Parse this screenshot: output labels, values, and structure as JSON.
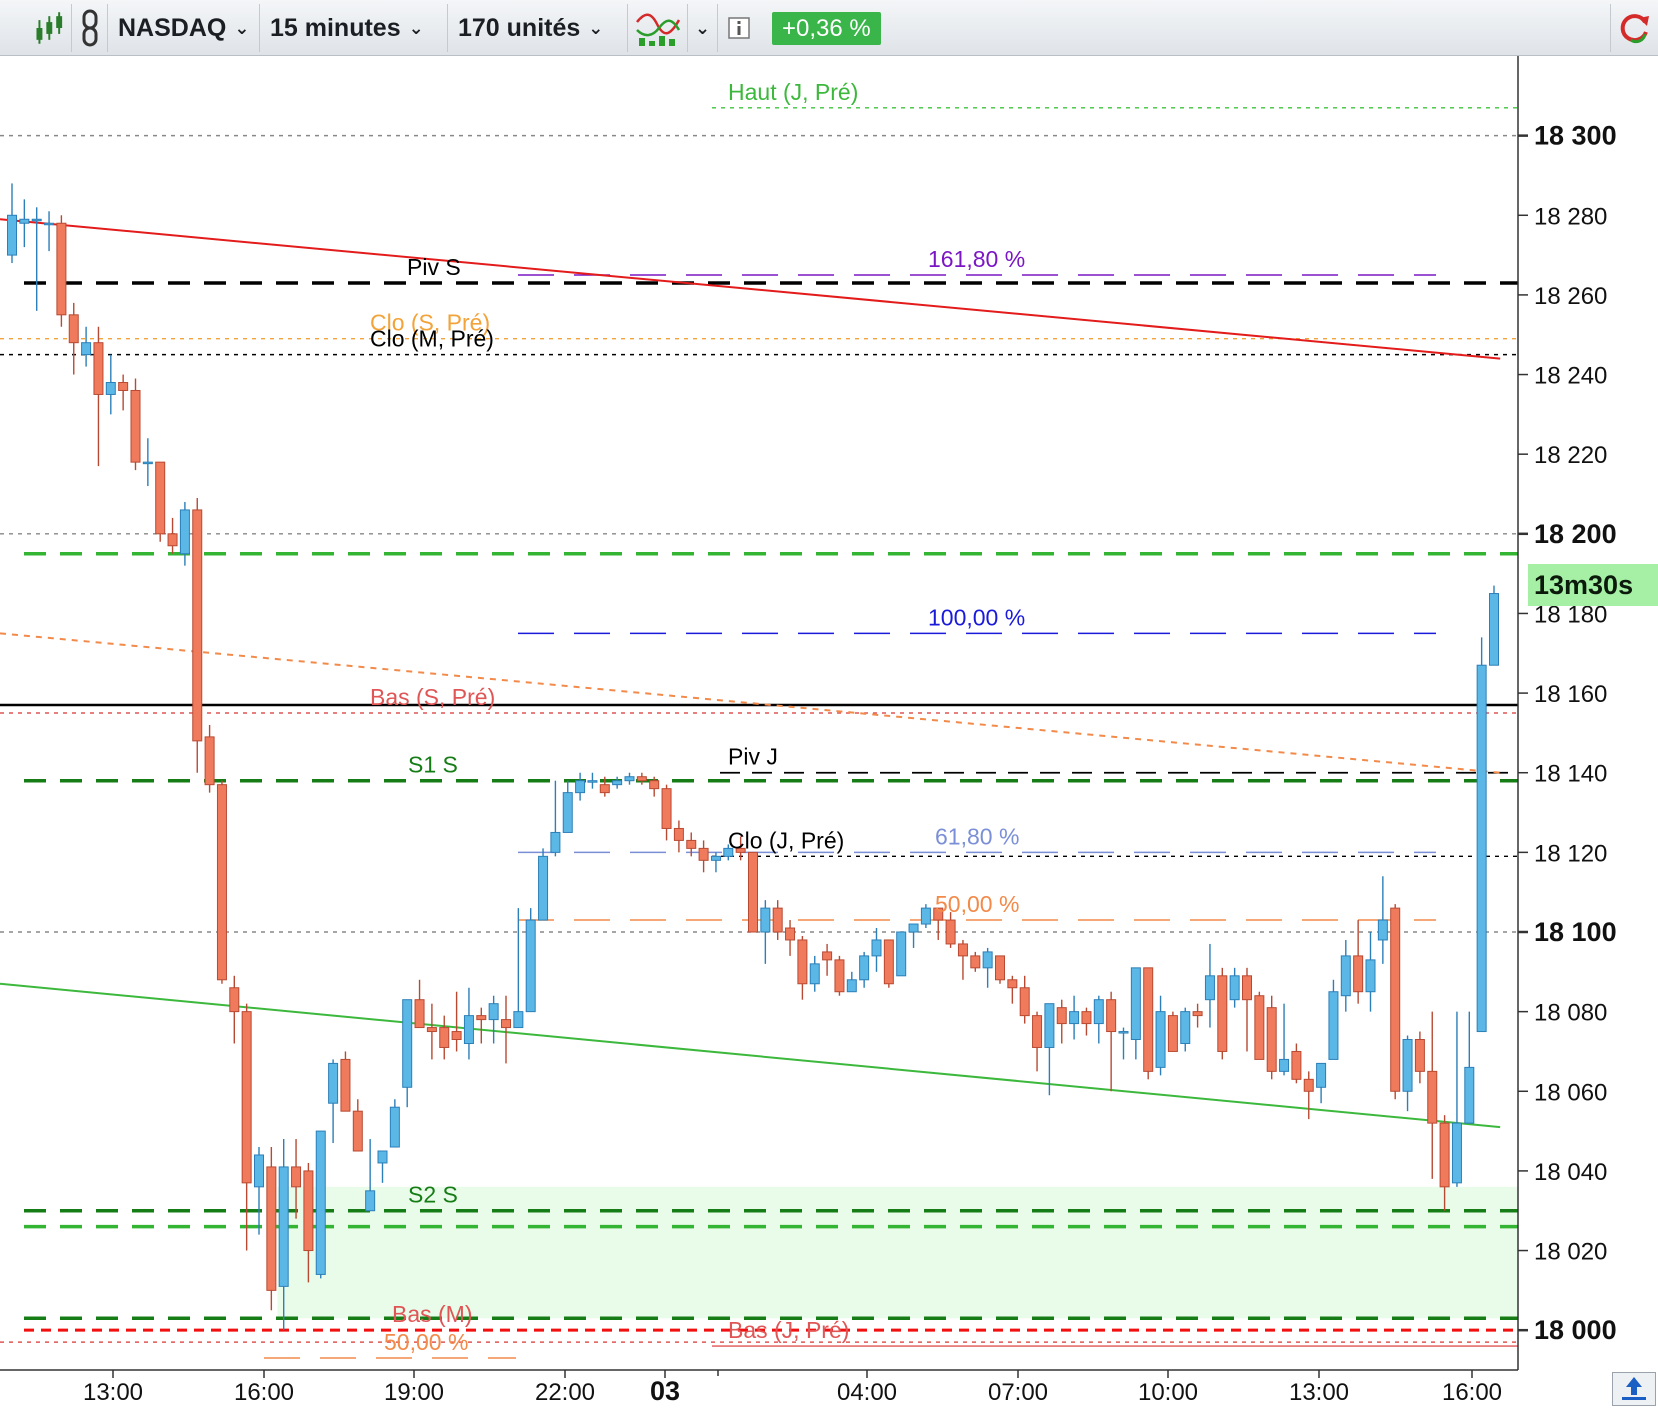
{
  "toolbar": {
    "symbol": "NASDAQ",
    "timeframe": "15 minutes",
    "units": "170 unités",
    "change": "+0,36 %",
    "icons": [
      "candlestick-icon",
      "link-icon",
      "indicator-icon",
      "info-icon",
      "refresh-icon"
    ]
  },
  "timer": "13m30s",
  "colors": {
    "up": "#5bb8e6",
    "down": "#f07a5c",
    "pivot_dark_green": "#167d16",
    "pivot_light_green": "#33b533",
    "fib_blue": "#1a1adb",
    "fib_purple": "#7b16c4",
    "fib_orange": "#f28a4a",
    "trend_red": "#e31b1b",
    "trend_green": "#3cb83c"
  },
  "chart_data": {
    "type": "candlestick",
    "ylim": [
      17990,
      18320
    ],
    "yticks": [
      {
        "value": 18300,
        "label": "18 300",
        "bold": true
      },
      {
        "value": 18280,
        "label": "18 280",
        "bold": false
      },
      {
        "value": 18260,
        "label": "18 260",
        "bold": false
      },
      {
        "value": 18240,
        "label": "18 240",
        "bold": false
      },
      {
        "value": 18220,
        "label": "18 220",
        "bold": false
      },
      {
        "value": 18200,
        "label": "18 200",
        "bold": true
      },
      {
        "value": 18180,
        "label": "18 180",
        "bold": false
      },
      {
        "value": 18160,
        "label": "18 160",
        "bold": false
      },
      {
        "value": 18140,
        "label": "18 140",
        "bold": false
      },
      {
        "value": 18120,
        "label": "18 120",
        "bold": false
      },
      {
        "value": 18100,
        "label": "18 100",
        "bold": true
      },
      {
        "value": 18080,
        "label": "18 080",
        "bold": false
      },
      {
        "value": 18060,
        "label": "18 060",
        "bold": false
      },
      {
        "value": 18040,
        "label": "18 040",
        "bold": false
      },
      {
        "value": 18020,
        "label": "18 020",
        "bold": false
      },
      {
        "value": 18000,
        "label": "18 000",
        "bold": true
      }
    ],
    "xticks": [
      {
        "label": "13:00",
        "bold": false
      },
      {
        "label": "16:00",
        "bold": false
      },
      {
        "label": "19:00",
        "bold": false
      },
      {
        "label": "22:00",
        "bold": false
      },
      {
        "label": "03",
        "bold": true
      },
      {
        "label": "04:00",
        "bold": false
      },
      {
        "label": "07:00",
        "bold": false
      },
      {
        "label": "10:00",
        "bold": false
      },
      {
        "label": "13:00",
        "bold": false
      },
      {
        "label": "16:00",
        "bold": false
      }
    ],
    "candles": [
      {
        "o": 18270,
        "h": 18288,
        "l": 18268,
        "c": 18280
      },
      {
        "o": 18278,
        "h": 18284,
        "l": 18272,
        "c": 18279
      },
      {
        "o": 18279,
        "h": 18282,
        "l": 18256,
        "c": 18279
      },
      {
        "o": 18278,
        "h": 18281,
        "l": 18271,
        "c": 18278
      },
      {
        "o": 18278,
        "h": 18280,
        "l": 18252,
        "c": 18255
      },
      {
        "o": 18255,
        "h": 18258,
        "l": 18240,
        "c": 18248
      },
      {
        "o": 18245,
        "h": 18252,
        "l": 18242,
        "c": 18248
      },
      {
        "o": 18248,
        "h": 18252,
        "l": 18217,
        "c": 18235
      },
      {
        "o": 18235,
        "h": 18245,
        "l": 18230,
        "c": 18238
      },
      {
        "o": 18238,
        "h": 18240,
        "l": 18231,
        "c": 18236
      },
      {
        "o": 18236,
        "h": 18239,
        "l": 18216,
        "c": 18218
      },
      {
        "o": 18218,
        "h": 18224,
        "l": 18212,
        "c": 18218
      },
      {
        "o": 18218,
        "h": 18218,
        "l": 18198,
        "c": 18200
      },
      {
        "o": 18200,
        "h": 18204,
        "l": 18195,
        "c": 18197
      },
      {
        "o": 18195,
        "h": 18208,
        "l": 18192,
        "c": 18206
      },
      {
        "o": 18206,
        "h": 18209,
        "l": 18140,
        "c": 18148
      },
      {
        "o": 18149,
        "h": 18152,
        "l": 18135,
        "c": 18137
      },
      {
        "o": 18137,
        "h": 18138,
        "l": 18087,
        "c": 18088
      },
      {
        "o": 18086,
        "h": 18089,
        "l": 18072,
        "c": 18080
      },
      {
        "o": 18080,
        "h": 18082,
        "l": 18020,
        "c": 18037
      },
      {
        "o": 18036,
        "h": 18046,
        "l": 18024,
        "c": 18044
      },
      {
        "o": 18041,
        "h": 18046,
        "l": 18005,
        "c": 18010
      },
      {
        "o": 18011,
        "h": 18048,
        "l": 18000,
        "c": 18041
      },
      {
        "o": 18041,
        "h": 18048,
        "l": 18028,
        "c": 18036
      },
      {
        "o": 18040,
        "h": 18042,
        "l": 18012,
        "c": 18020
      },
      {
        "o": 18014,
        "h": 18050,
        "l": 18013,
        "c": 18050
      },
      {
        "o": 18057,
        "h": 18068,
        "l": 18047,
        "c": 18067
      },
      {
        "o": 18068,
        "h": 18070,
        "l": 18055,
        "c": 18055
      },
      {
        "o": 18055,
        "h": 18058,
        "l": 18045,
        "c": 18045
      },
      {
        "o": 18030,
        "h": 18048,
        "l": 18030,
        "c": 18035
      },
      {
        "o": 18042,
        "h": 18045,
        "l": 18037,
        "c": 18045
      },
      {
        "o": 18046,
        "h": 18058,
        "l": 18046,
        "c": 18056
      },
      {
        "o": 18061,
        "h": 18083,
        "l": 18056,
        "c": 18083
      },
      {
        "o": 18083,
        "h": 18088,
        "l": 18078,
        "c": 18076
      },
      {
        "o": 18076,
        "h": 18082,
        "l": 18068,
        "c": 18075
      },
      {
        "o": 18076,
        "h": 18079,
        "l": 18068,
        "c": 18071
      },
      {
        "o": 18075,
        "h": 18085,
        "l": 18070,
        "c": 18073
      },
      {
        "o": 18072,
        "h": 18086,
        "l": 18068,
        "c": 18079
      },
      {
        "o": 18079,
        "h": 18081,
        "l": 18072,
        "c": 18078
      },
      {
        "o": 18078,
        "h": 18084,
        "l": 18072,
        "c": 18082
      },
      {
        "o": 18078,
        "h": 18084,
        "l": 18067,
        "c": 18076
      },
      {
        "o": 18076,
        "h": 18106,
        "l": 18076,
        "c": 18080
      },
      {
        "o": 18080,
        "h": 18106,
        "l": 18080,
        "c": 18103
      },
      {
        "o": 18103,
        "h": 18121,
        "l": 18103,
        "c": 18119
      },
      {
        "o": 18120,
        "h": 18138,
        "l": 18119,
        "c": 18125
      },
      {
        "o": 18125,
        "h": 18138,
        "l": 18125,
        "c": 18135
      },
      {
        "o": 18135,
        "h": 18140,
        "l": 18133,
        "c": 18138
      },
      {
        "o": 18138,
        "h": 18140,
        "l": 18136,
        "c": 18138
      },
      {
        "o": 18137,
        "h": 18139,
        "l": 18134,
        "c": 18135
      },
      {
        "o": 18137,
        "h": 18139,
        "l": 18136,
        "c": 18138
      },
      {
        "o": 18138,
        "h": 18140,
        "l": 18137,
        "c": 18139
      },
      {
        "o": 18139,
        "h": 18140,
        "l": 18137,
        "c": 18138
      },
      {
        "o": 18138,
        "h": 18139,
        "l": 18134,
        "c": 18136
      },
      {
        "o": 18136,
        "h": 18137,
        "l": 18123,
        "c": 18126
      },
      {
        "o": 18126,
        "h": 18128,
        "l": 18120,
        "c": 18123
      },
      {
        "o": 18123,
        "h": 18125,
        "l": 18119,
        "c": 18121
      },
      {
        "o": 18121,
        "h": 18123,
        "l": 18115,
        "c": 18118
      },
      {
        "o": 18118,
        "h": 18120,
        "l": 18115,
        "c": 18119
      },
      {
        "o": 18119,
        "h": 18122,
        "l": 18118,
        "c": 18121
      },
      {
        "o": 18121,
        "h": 18124,
        "l": 18118,
        "c": 18120
      },
      {
        "o": 18120,
        "h": 18120,
        "l": 18100,
        "c": 18100
      },
      {
        "o": 18100,
        "h": 18108,
        "l": 18092,
        "c": 18106
      },
      {
        "o": 18106,
        "h": 18108,
        "l": 18098,
        "c": 18100
      },
      {
        "o": 18101,
        "h": 18103,
        "l": 18094,
        "c": 18098
      },
      {
        "o": 18098,
        "h": 18099,
        "l": 18083,
        "c": 18087
      },
      {
        "o": 18087,
        "h": 18094,
        "l": 18085,
        "c": 18092
      },
      {
        "o": 18095,
        "h": 18097,
        "l": 18089,
        "c": 18093
      },
      {
        "o": 18093,
        "h": 18094,
        "l": 18084,
        "c": 18085
      },
      {
        "o": 18085,
        "h": 18090,
        "l": 18085,
        "c": 18088
      },
      {
        "o": 18088,
        "h": 18095,
        "l": 18086,
        "c": 18094
      },
      {
        "o": 18094,
        "h": 18101,
        "l": 18090,
        "c": 18098
      },
      {
        "o": 18098,
        "h": 18098,
        "l": 18086,
        "c": 18087
      },
      {
        "o": 18089,
        "h": 18100,
        "l": 18089,
        "c": 18100
      },
      {
        "o": 18100,
        "h": 18102,
        "l": 18096,
        "c": 18102
      },
      {
        "o": 18102,
        "h": 18107,
        "l": 18101,
        "c": 18106
      },
      {
        "o": 18106,
        "h": 18106,
        "l": 18098,
        "c": 18103
      },
      {
        "o": 18103,
        "h": 18105,
        "l": 18096,
        "c": 18097
      },
      {
        "o": 18097,
        "h": 18098,
        "l": 18088,
        "c": 18094
      },
      {
        "o": 18094,
        "h": 18095,
        "l": 18090,
        "c": 18091
      },
      {
        "o": 18091,
        "h": 18096,
        "l": 18086,
        "c": 18095
      },
      {
        "o": 18094,
        "h": 18094,
        "l": 18087,
        "c": 18088
      },
      {
        "o": 18088,
        "h": 18089,
        "l": 18082,
        "c": 18086
      },
      {
        "o": 18086,
        "h": 18089,
        "l": 18077,
        "c": 18079
      },
      {
        "o": 18079,
        "h": 18080,
        "l": 18065,
        "c": 18071
      },
      {
        "o": 18071,
        "h": 18082,
        "l": 18059,
        "c": 18082
      },
      {
        "o": 18081,
        "h": 18083,
        "l": 18072,
        "c": 18077
      },
      {
        "o": 18077,
        "h": 18084,
        "l": 18073,
        "c": 18080
      },
      {
        "o": 18080,
        "h": 18081,
        "l": 18074,
        "c": 18077
      },
      {
        "o": 18077,
        "h": 18084,
        "l": 18072,
        "c": 18083
      },
      {
        "o": 18083,
        "h": 18085,
        "l": 18060,
        "c": 18075
      },
      {
        "o": 18075,
        "h": 18076,
        "l": 18068,
        "c": 18075
      },
      {
        "o": 18073,
        "h": 18091,
        "l": 18068,
        "c": 18091
      },
      {
        "o": 18091,
        "h": 18091,
        "l": 18063,
        "c": 18065
      },
      {
        "o": 18066,
        "h": 18084,
        "l": 18064,
        "c": 18080
      },
      {
        "o": 18079,
        "h": 18080,
        "l": 18070,
        "c": 18070
      },
      {
        "o": 18072,
        "h": 18081,
        "l": 18070,
        "c": 18080
      },
      {
        "o": 18080,
        "h": 18082,
        "l": 18076,
        "c": 18079
      },
      {
        "o": 18083,
        "h": 18097,
        "l": 18076,
        "c": 18089
      },
      {
        "o": 18089,
        "h": 18091,
        "l": 18068,
        "c": 18070
      },
      {
        "o": 18083,
        "h": 18091,
        "l": 18081,
        "c": 18089
      },
      {
        "o": 18089,
        "h": 18091,
        "l": 18070,
        "c": 18083
      },
      {
        "o": 18084,
        "h": 18085,
        "l": 18068,
        "c": 18068
      },
      {
        "o": 18081,
        "h": 18084,
        "l": 18063,
        "c": 18065
      },
      {
        "o": 18065,
        "h": 18082,
        "l": 18064,
        "c": 18068
      },
      {
        "o": 18070,
        "h": 18072,
        "l": 18062,
        "c": 18063
      },
      {
        "o": 18063,
        "h": 18065,
        "l": 18053,
        "c": 18060
      },
      {
        "o": 18061,
        "h": 18067,
        "l": 18057,
        "c": 18067
      },
      {
        "o": 18068,
        "h": 18088,
        "l": 18068,
        "c": 18085
      },
      {
        "o": 18084,
        "h": 18098,
        "l": 18080,
        "c": 18094
      },
      {
        "o": 18094,
        "h": 18103,
        "l": 18082,
        "c": 18085
      },
      {
        "o": 18085,
        "h": 18100,
        "l": 18080,
        "c": 18093
      },
      {
        "o": 18098,
        "h": 18114,
        "l": 18092,
        "c": 18103
      },
      {
        "o": 18106,
        "h": 18107,
        "l": 18058,
        "c": 18060
      },
      {
        "o": 18060,
        "h": 18074,
        "l": 18055,
        "c": 18073
      },
      {
        "o": 18073,
        "h": 18075,
        "l": 18062,
        "c": 18065
      },
      {
        "o": 18065,
        "h": 18080,
        "l": 18038,
        "c": 18052
      },
      {
        "o": 18052,
        "h": 18054,
        "l": 18030,
        "c": 18036
      },
      {
        "o": 18037,
        "h": 18080,
        "l": 18036,
        "c": 18052
      },
      {
        "o": 18052,
        "h": 18080,
        "l": 18052,
        "c": 18066
      },
      {
        "o": 18075,
        "h": 18174,
        "l": 18075,
        "c": 18167
      },
      {
        "o": 18167,
        "h": 18187,
        "l": 18167,
        "c": 18185
      }
    ],
    "horizontal_levels": [
      {
        "value": 18307,
        "color": "#3cc43c",
        "style": "fine",
        "label": "Haut (J, Pré)",
        "label_color": "#3cb83c"
      },
      {
        "value": 18300,
        "color": "#888888",
        "style": "fine",
        "label": "",
        "label_color": ""
      },
      {
        "value": 18263,
        "color": "#000000",
        "style": "thick",
        "label": "Piv S",
        "label_color": "#000000"
      },
      {
        "value": 18249,
        "color": "#f2a33a",
        "style": "fine",
        "label": "Clo (S, Pré)",
        "label_color": "#f2a33a"
      },
      {
        "value": 18245,
        "color": "#000000",
        "style": "fine",
        "label": "Clo (M, Pré)",
        "label_color": "#000000"
      },
      {
        "value": 18200,
        "color": "#888888",
        "style": "fine",
        "label": "",
        "label_color": ""
      },
      {
        "value": 18195,
        "color": "#33b533",
        "style": "thick",
        "label": "",
        "label_color": ""
      },
      {
        "value": 18157,
        "color": "#000000",
        "style": "solid",
        "label": "",
        "label_color": ""
      },
      {
        "value": 18155,
        "color": "#e05555",
        "style": "fine",
        "label": "Bas (S, Pré)",
        "label_color": "#e05555"
      },
      {
        "value": 18140,
        "color": "#000000",
        "style": "medium",
        "label": "Piv J",
        "label_color": "#000000"
      },
      {
        "value": 18138,
        "color": "#167d16",
        "style": "thick",
        "label": "S1 S",
        "label_color": "#167d16"
      },
      {
        "value": 18119,
        "color": "#000000",
        "style": "fine",
        "label": "Clo (J, Pré)",
        "label_color": "#000000"
      },
      {
        "value": 18100,
        "color": "#888888",
        "style": "fine",
        "label": "",
        "label_color": ""
      },
      {
        "value": 18030,
        "color": "#167d16",
        "style": "thick",
        "label": "S2 S",
        "label_color": "#167d16"
      },
      {
        "value": 18026,
        "color": "#33b533",
        "style": "thick",
        "label": "",
        "label_color": ""
      },
      {
        "value": 18003,
        "color": "#167d16",
        "style": "thick",
        "label": "",
        "label_color": ""
      },
      {
        "value": 18000,
        "color": "#f20f0f",
        "style": "red",
        "label": "Bas (M)",
        "label_color": "#e05555"
      },
      {
        "value": 17997,
        "color": "#e05555",
        "style": "fine",
        "label": "",
        "label_color": ""
      },
      {
        "value": 17996,
        "color": "#e05555",
        "style": "solidthin",
        "label": "Bas (J, Pré)",
        "label_color": "#e05555"
      }
    ],
    "fib_levels": [
      {
        "value": 18265,
        "label": "161,80 %",
        "color": "#7b16c4"
      },
      {
        "value": 18175,
        "label": "100,00 %",
        "color": "#1a1adb"
      },
      {
        "value": 18120,
        "label": "61,80 %",
        "color": "#7b8fd6"
      },
      {
        "value": 18103,
        "label": "50,00 %",
        "color": "#f28a4a"
      },
      {
        "value": 17993,
        "label": "50,00 %",
        "color": "#f28a4a"
      }
    ],
    "trendlines": [
      {
        "from": [
          0,
          18279
        ],
        "to": [
          120.5,
          18244
        ],
        "color": "#e31b1b",
        "style": "solid"
      },
      {
        "from": [
          0,
          18175
        ],
        "to": [
          120.5,
          18140
        ],
        "color": "#f28a4a",
        "style": "dashed"
      },
      {
        "from": [
          0,
          18087
        ],
        "to": [
          120.5,
          18051
        ],
        "color": "#3cb83c",
        "style": "solid"
      }
    ],
    "zone": {
      "from": 21.5,
      "to": 120.5,
      "low": 18003,
      "high": 18036,
      "color": "#e9fbe9"
    }
  }
}
